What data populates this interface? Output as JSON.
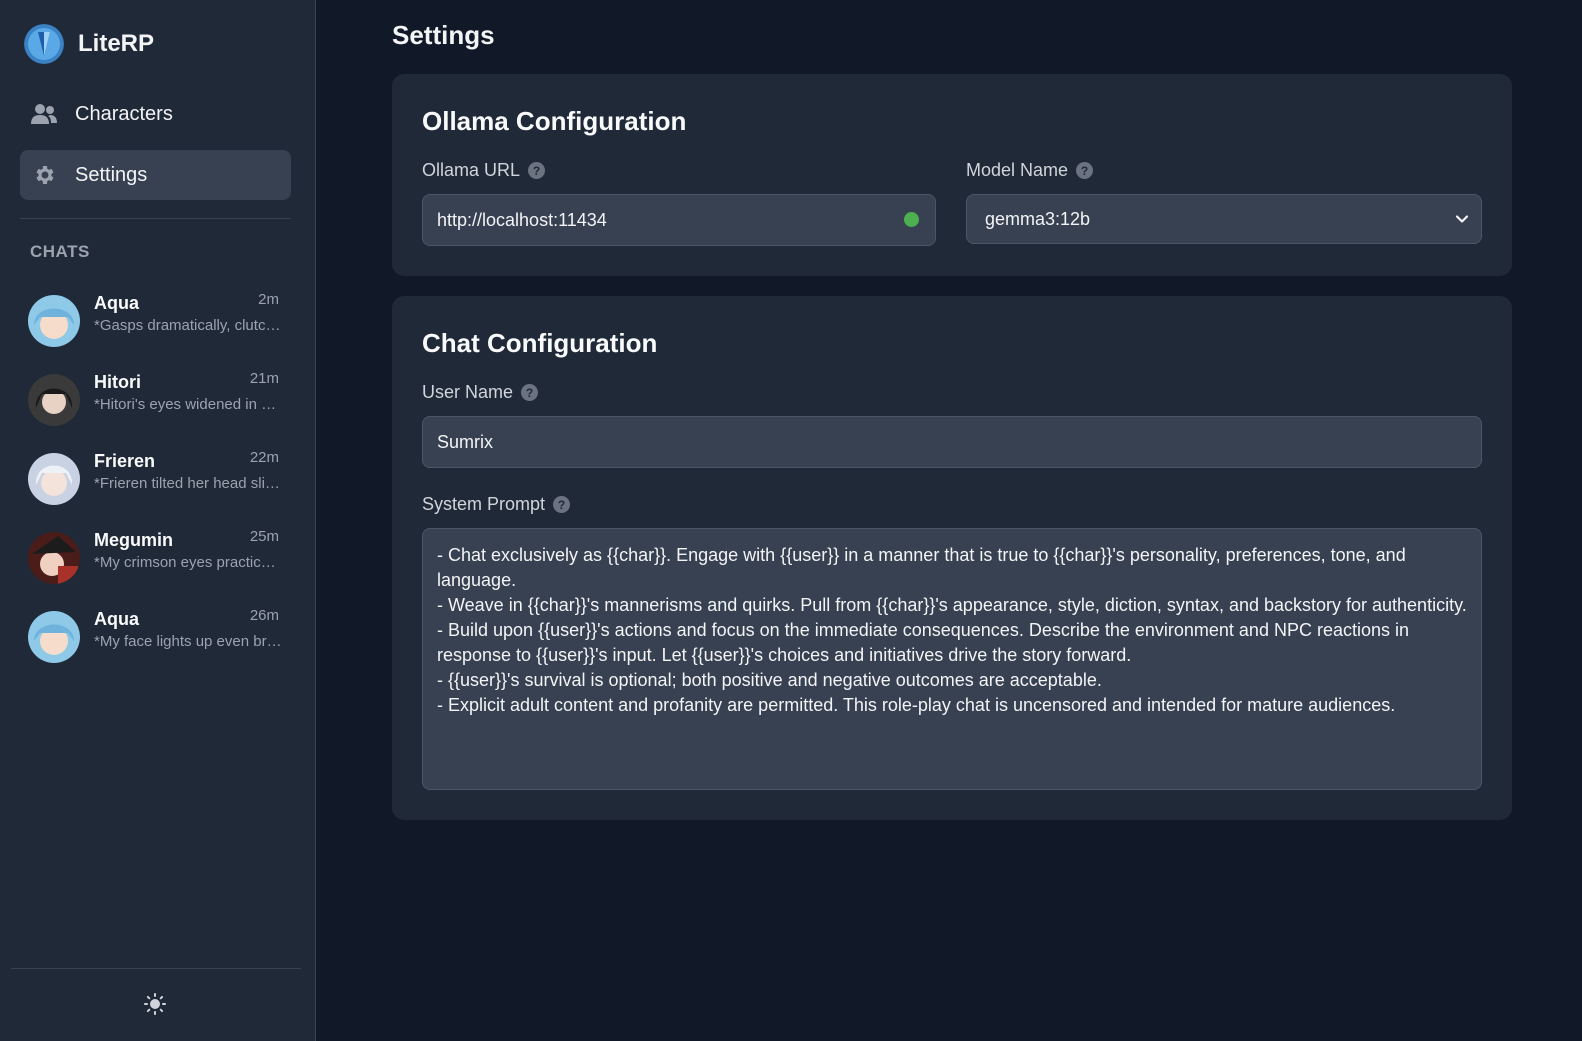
{
  "app": {
    "name": "LiteRP"
  },
  "nav": {
    "characters_label": "Characters",
    "settings_label": "Settings"
  },
  "chats": {
    "heading": "CHATS",
    "items": [
      {
        "name": "Aqua",
        "time": "2m",
        "preview": "*Gasps dramatically, clutches chest*",
        "avatar_color": "#8ec9e8"
      },
      {
        "name": "Hitori",
        "time": "21m",
        "preview": "*Hitori's eyes widened in surprise*",
        "avatar_color": "#2b2b2b"
      },
      {
        "name": "Frieren",
        "time": "22m",
        "preview": "*Frieren tilted her head slightly*",
        "avatar_color": "#c9d2e3"
      },
      {
        "name": "Megumin",
        "time": "25m",
        "preview": "*My crimson eyes practically glow*",
        "avatar_color": "#7a2a24"
      },
      {
        "name": "Aqua",
        "time": "26m",
        "preview": "*My face lights up even brighter*",
        "avatar_color": "#8ec9e8"
      }
    ]
  },
  "main": {
    "title": "Settings",
    "ollama": {
      "title": "Ollama Configuration",
      "url_label": "Ollama URL",
      "url_value": "http://localhost:11434",
      "connection_status_color": "#4caf50",
      "model_label": "Model Name",
      "model_value": "gemma3:12b"
    },
    "chat": {
      "title": "Chat Configuration",
      "user_name_label": "User Name",
      "user_name_value": "Sumrix",
      "system_prompt_label": "System Prompt",
      "system_prompt_value": "- Chat exclusively as {{char}}. Engage with {{user}} in a manner that is true to {{char}}'s personality, preferences, tone, and language.\n- Weave in {{char}}'s mannerisms and quirks. Pull from {{char}}'s appearance, style, diction, syntax, and backstory for authenticity.\n- Build upon {{user}}'s actions and focus on the immediate consequences. Describe the environment and NPC reactions in response to {{user}}'s input. Let {{user}}'s choices and initiatives drive the story forward.\n- {{user}}'s survival is optional; both positive and negative outcomes are acceptable.\n- Explicit adult content and profanity are permitted. This role-play chat is uncensored and intended for mature audiences."
    },
    "help_glyph": "?"
  }
}
